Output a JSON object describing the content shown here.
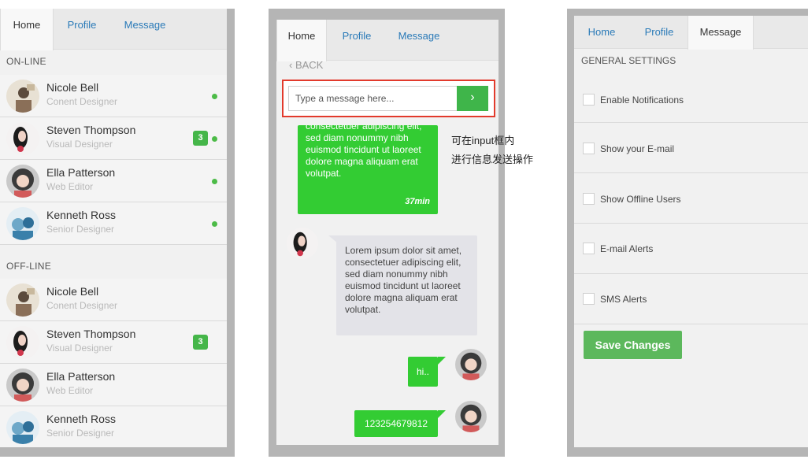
{
  "panel1": {
    "tabs": [
      "Home",
      "Profile",
      "Message"
    ],
    "online_title": "ON-LINE",
    "offline_title": "OFF-LINE",
    "online": [
      {
        "name": "Nicole Bell",
        "role": "Conent Designer",
        "badge": ""
      },
      {
        "name": "Steven Thompson",
        "role": "Visual Designer",
        "badge": "3"
      },
      {
        "name": "Ella Patterson",
        "role": "Web Editor",
        "badge": ""
      },
      {
        "name": "Kenneth Ross",
        "role": "Senior Designer",
        "badge": ""
      }
    ],
    "offline": [
      {
        "name": "Nicole Bell",
        "role": "Conent Designer",
        "badge": ""
      },
      {
        "name": "Steven Thompson",
        "role": "Visual Designer",
        "badge": "3"
      },
      {
        "name": "Ella Patterson",
        "role": "Web Editor",
        "badge": ""
      },
      {
        "name": "Kenneth Ross",
        "role": "Senior Designer",
        "badge": ""
      }
    ]
  },
  "panel2": {
    "tabs": [
      "Home",
      "Profile",
      "Message"
    ],
    "back": "BACK",
    "input_placeholder": "Type a message here...",
    "send_icon": "chevron-right-icon",
    "messages": [
      {
        "from": "me",
        "text": "consectetuer adipiscing elit, sed diam nonummy nibh euismod tincidunt ut laoreet dolore magna aliquam erat volutpat.",
        "time": "37min"
      },
      {
        "from": "other",
        "text": "Lorem ipsum dolor sit amet, consectetuer adipiscing elit, sed diam nonummy nibh euismod tincidunt ut laoreet dolore magna aliquam erat volutpat."
      },
      {
        "from": "me",
        "text": "hi.."
      },
      {
        "from": "me",
        "text": "123254679812"
      }
    ],
    "annotation_lines": [
      "可在input框内",
      "进行信息发送操作"
    ]
  },
  "panel3": {
    "tabs": [
      "Home",
      "Profile",
      "Message"
    ],
    "heading": "GENERAL SETTINGS",
    "settings": [
      "Enable Notifications",
      "Show your E-mail",
      "Show Offline Users",
      "E-mail Alerts",
      "SMS Alerts"
    ],
    "save_label": "Save Changes"
  },
  "colors": {
    "accent": "#2a7ab8",
    "online": "#4cbb47",
    "bubble_green": "#33cc33",
    "highlight_border": "#e23a2c",
    "button_green": "#5cb85c"
  }
}
